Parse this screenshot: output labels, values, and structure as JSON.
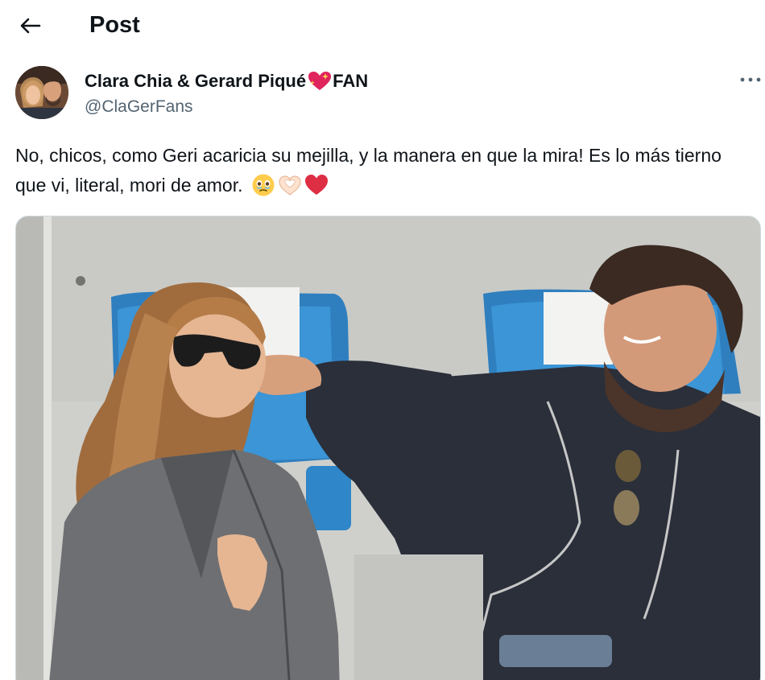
{
  "header": {
    "title": "Post",
    "back_icon": "arrow-left-icon"
  },
  "author": {
    "name_prefix": "Clara Chia & Gerard Piqué",
    "name_suffix": "FAN",
    "name_emoji": "sparkling-heart-icon",
    "handle": "@ClaGerFans",
    "more_icon": "more-horizontal-icon"
  },
  "tweet": {
    "text": "No, chicos, como Geri acaricia su mejilla, y la manera en que la mira! Es lo más tierno que vi, literal, mori de amor.",
    "emojis": [
      "face-holding-back-tears-icon",
      "heart-hands-icon",
      "red-heart-icon"
    ]
  },
  "media": {
    "type": "photo",
    "description_icon": "photo-icon"
  },
  "colors": {
    "text": "#0f1419",
    "secondary": "#536471",
    "heart": "#e0245e",
    "border": "#cfd9de"
  }
}
